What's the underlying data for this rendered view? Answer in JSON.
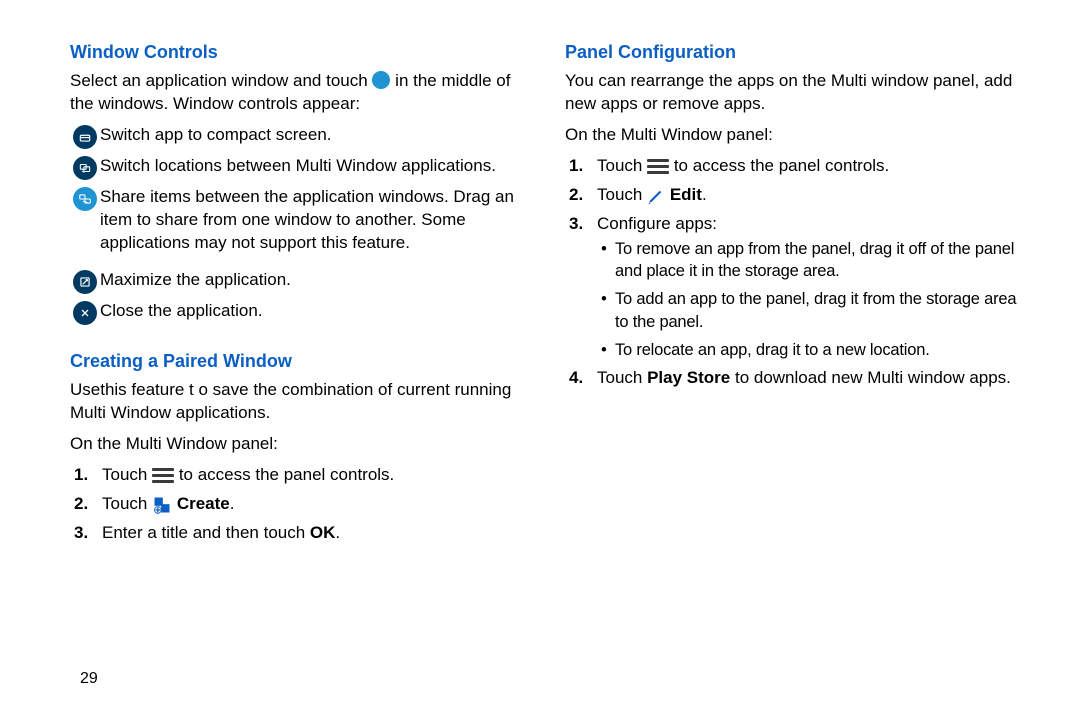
{
  "page_number": "29",
  "left": {
    "window_controls": {
      "heading": "Window Controls",
      "intro_a": "Select an application window and touch ",
      "intro_b": " in the middle of the windows. Window controls appear:",
      "items": [
        "Switch app to compact screen.",
        "Switch locations between Multi Window applications.",
        "Share items between the application windows. Drag an item to share from one window to another. Some applications may not support this feature.",
        "Maximize the application.",
        "Close the application."
      ]
    },
    "paired": {
      "heading": "Creating a Paired Window",
      "desc": "Usethis feature t o save the combination of current running Multi Window applications.",
      "on_panel": "On the Multi Window panel:",
      "step1_a": "Touch ",
      "step1_b": " to access the panel controls.",
      "step2_a": "Touch ",
      "step2_b": "Create",
      "step2_c": ".",
      "step3_a": "Enter a title and then touch ",
      "step3_b": "OK",
      "step3_c": "."
    }
  },
  "right": {
    "panel_config": {
      "heading": "Panel Configuration",
      "desc": "You can rearrange the apps on the Multi window panel, add new apps or remove apps.",
      "on_panel": "On the Multi Window panel:",
      "step1_a": "Touch ",
      "step1_b": " to access the panel controls.",
      "step2_a": "Touch ",
      "step2_b": "Edit",
      "step2_c": ".",
      "step3": "Configure apps:",
      "bullets": [
        "To remove an app from the panel, drag it off of the panel and place it in the storage area.",
        "To add an app to the panel, drag it from the storage area to the panel.",
        "To relocate an app, drag it to a new location."
      ],
      "step4_a": "Touch ",
      "step4_b": "Play Store",
      "step4_c": " to download new Multi window apps."
    }
  }
}
